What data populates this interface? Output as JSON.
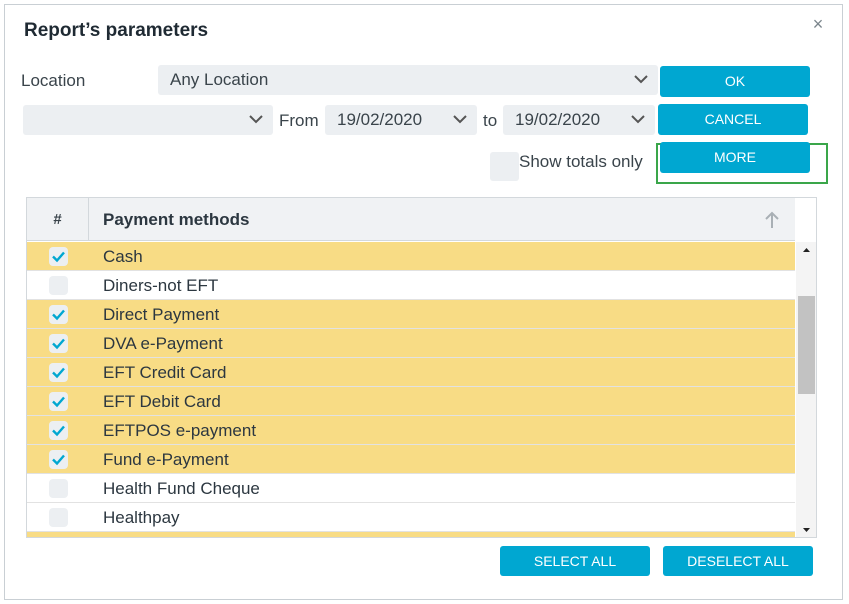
{
  "dialog": {
    "title": "Report’s parameters",
    "close_glyph": "×"
  },
  "location": {
    "label": "Location",
    "value": "Any Location"
  },
  "period_select": {
    "value": ""
  },
  "from": {
    "label": "From",
    "value": "19/02/2020"
  },
  "to": {
    "label": "to",
    "value": "19/02/2020"
  },
  "buttons": {
    "ok": "OK",
    "cancel": "CANCEL",
    "more": "MORE",
    "select_all": "SELECT ALL",
    "deselect_all": "DESELECT ALL"
  },
  "show_totals": {
    "label": "Show totals only",
    "checked": false
  },
  "grid": {
    "col_hash": "#",
    "col_title": "Payment methods",
    "rows": [
      {
        "name": "Cash",
        "checked": true
      },
      {
        "name": "Diners-not EFT",
        "checked": false
      },
      {
        "name": "Direct Payment",
        "checked": true
      },
      {
        "name": "DVA e-Payment",
        "checked": true
      },
      {
        "name": "EFT Credit Card",
        "checked": true
      },
      {
        "name": "EFT Debit Card",
        "checked": true
      },
      {
        "name": "EFTPOS e-payment",
        "checked": true
      },
      {
        "name": "Fund e-Payment",
        "checked": true
      },
      {
        "name": "Health Fund Cheque",
        "checked": false
      },
      {
        "name": "Healthpay",
        "checked": false
      },
      {
        "name": "",
        "checked": true
      }
    ]
  },
  "colors": {
    "accent": "#00a7d1",
    "selected_row": "#f8dc85",
    "highlight_border": "#3aa64a"
  }
}
